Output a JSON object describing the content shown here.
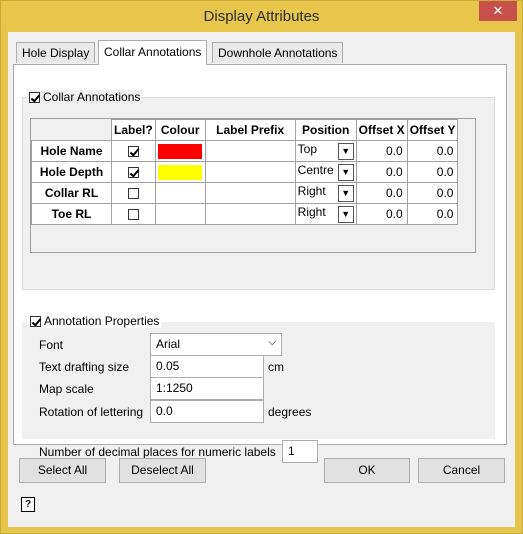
{
  "window": {
    "title": "Display Attributes",
    "close_glyph": "✕"
  },
  "tabs": [
    {
      "label": "Hole Display",
      "active": false
    },
    {
      "label": "Collar Annotations",
      "active": true
    },
    {
      "label": "Downhole Annotations",
      "active": false
    }
  ],
  "collar_annotations": {
    "label": "Collar Annotations",
    "checked": true,
    "columns": [
      "Label?",
      "Colour",
      "Label Prefix",
      "Position",
      "Offset X",
      "Offset Y"
    ],
    "rows": [
      {
        "name": "Hole Name",
        "label": true,
        "colour": "#ff0000",
        "prefix": "",
        "position": "Top",
        "offset_x": "0.0",
        "offset_y": "0.0"
      },
      {
        "name": "Hole Depth",
        "label": true,
        "colour": "#ffff00",
        "prefix": "",
        "position": "Centre",
        "offset_x": "0.0",
        "offset_y": "0.0"
      },
      {
        "name": "Collar RL",
        "label": false,
        "colour": "",
        "prefix": "",
        "position": "Right",
        "offset_x": "0.0",
        "offset_y": "0.0"
      },
      {
        "name": "Toe RL",
        "label": false,
        "colour": "",
        "prefix": "",
        "position": "Right",
        "offset_x": "0.0",
        "offset_y": "0.0"
      }
    ]
  },
  "annotation_properties": {
    "label": "Annotation Properties",
    "checked": true,
    "font_label": "Font",
    "font_value": "Arial",
    "text_size_label": "Text drafting size",
    "text_size_value": "0.05",
    "text_size_unit": "cm",
    "map_scale_label": "Map scale",
    "map_scale_value": "1:1250",
    "rotation_label": "Rotation of lettering",
    "rotation_value": "0.0",
    "rotation_unit": "degrees",
    "decimal_label": "Number of decimal places for numeric labels",
    "decimal_value": "1"
  },
  "buttons": {
    "select_all": "Select All",
    "deselect_all": "Deselect All",
    "ok": "OK",
    "cancel": "Cancel"
  },
  "help_glyph": "?"
}
